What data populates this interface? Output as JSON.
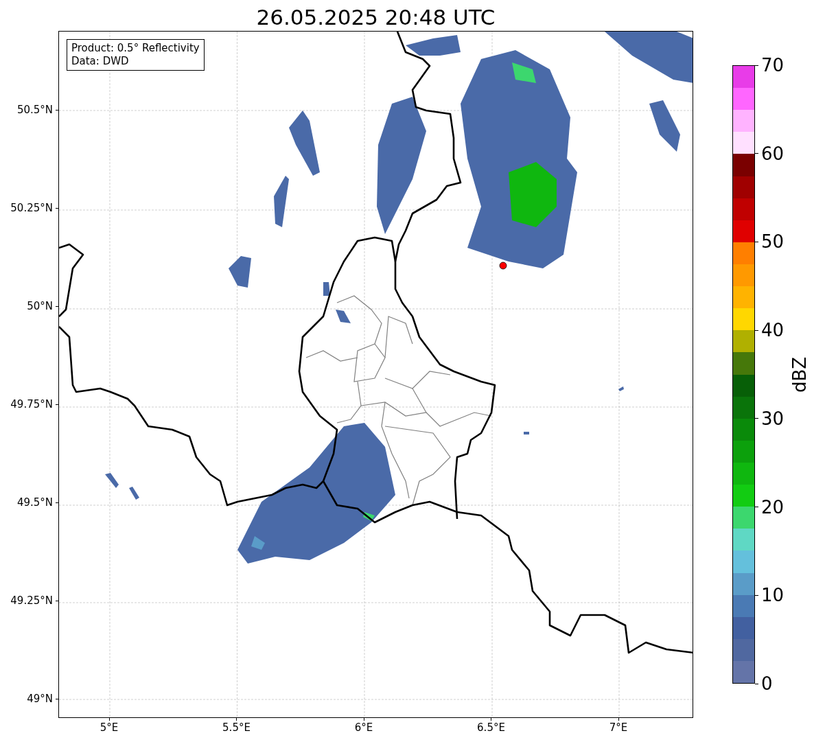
{
  "title": "26.05.2025 20:48 UTC",
  "legend": [
    "Product: 0.5° Reflectivity",
    "Data: DWD"
  ],
  "lat_ticks": [
    "50.5°N",
    "50.25°N",
    "50°N",
    "49.75°N",
    "49.5°N",
    "49.25°N",
    "49°N"
  ],
  "lon_ticks": [
    "5°E",
    "5.5°E",
    "6°E",
    "6.5°E",
    "7°E"
  ],
  "colorbar": {
    "label": "dBZ",
    "ticks": [
      "70",
      "60",
      "50",
      "40",
      "30",
      "20",
      "10",
      "0"
    ],
    "segments": [
      {
        "color": "#6474a8"
      },
      {
        "color": "#5068a0"
      },
      {
        "color": "#4260a0"
      },
      {
        "color": "#4a7ab4"
      },
      {
        "color": "#5a9cc8"
      },
      {
        "color": "#64c0dc"
      },
      {
        "color": "#5fd8c4"
      },
      {
        "color": "#3cd76e"
      },
      {
        "color": "#12cc12"
      },
      {
        "color": "#0fb70f"
      },
      {
        "color": "#0ca00c"
      },
      {
        "color": "#0a8a0a"
      },
      {
        "color": "#0a740a"
      },
      {
        "color": "#075f07"
      },
      {
        "color": "#46780a"
      },
      {
        "color": "#b0b000"
      },
      {
        "color": "#ffd700"
      },
      {
        "color": "#ffb300"
      },
      {
        "color": "#ff9900"
      },
      {
        "color": "#ff7f00"
      },
      {
        "color": "#e00000"
      },
      {
        "color": "#c00000"
      },
      {
        "color": "#a00000"
      },
      {
        "color": "#7a0000"
      },
      {
        "color": "#ffe0ff"
      },
      {
        "color": "#ffb3ff"
      },
      {
        "color": "#ff66ff"
      },
      {
        "color": "#e83ce8"
      }
    ]
  }
}
